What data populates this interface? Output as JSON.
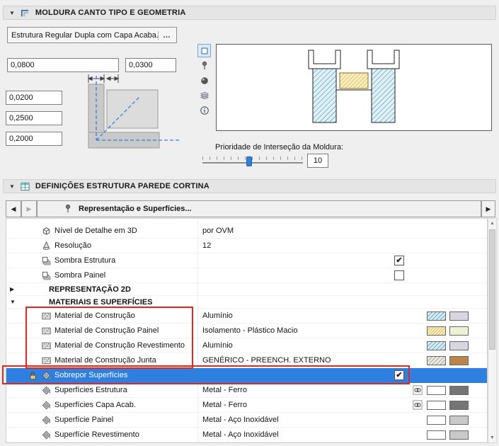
{
  "icons": {
    "panel_collapse": "▼",
    "group_collapsed": "▶",
    "group_expanded": "▼",
    "nav_left": "◀",
    "nav_right": "▶",
    "check": "✔",
    "scroll_up": "▲",
    "scroll_down": "▼"
  },
  "colors": {
    "selection_blue": "#2e7fe0",
    "annotation_red": "#e0281c",
    "slider_handle_blue": "#2e7fe0",
    "aluminium_hatch_bg": "#d9edf4",
    "aluminium_solid": "#d8d5e0",
    "insulation_hatch_bg": "#faf0c0",
    "insulation_solid": "#eef2d5",
    "generic_hatch_bg": "#e9e9e1",
    "generic_solid": "#b9854c",
    "metal_dark": "#757575",
    "metal_light": "#c9c9c9"
  },
  "panel_frame": {
    "title": "MOLDURA CANTO TIPO E GEOMETRIA",
    "structure_button_label": "Estrutura Regular Dupla com Capa Acaba...",
    "structure_button_more": "…",
    "width_value": "0,0800",
    "depth_value": "0,0300",
    "dim_a_value": "0,0200",
    "dim_b_value": "0,2500",
    "dim_c_value": "0,2000",
    "priority_label": "Prioridade de Interseção da Moldura:",
    "priority_value": "10"
  },
  "panel_settings": {
    "title": "DEFINIÇÕES ESTRUTURA PAREDE CORTINA",
    "page_selector_label": "Representação e Superfícies...",
    "rows": [
      {
        "label": "Nível de Detalhe em 3D",
        "value": "por OVM"
      },
      {
        "label": "Resolução",
        "value": "12"
      },
      {
        "label": "Sombra Estrutura",
        "checkbox": "checked"
      },
      {
        "label": "Sombra Painel",
        "checkbox": "unchecked"
      },
      {
        "label": "REPRESENTAÇÃO 2D",
        "group": true,
        "expanded": false
      },
      {
        "label": "MATERIAIS E SUPERFÍCIES",
        "group": true,
        "expanded": true
      },
      {
        "label": "Material de Construção",
        "value": "Alumínio",
        "swatches": [
          "aluminium-hatch",
          "aluminium-solid"
        ]
      },
      {
        "label": "Material de Construção Painel",
        "value": "Isolamento - Plástico Macio",
        "swatches": [
          "insulation-hatch",
          "insulation-solid"
        ]
      },
      {
        "label": "Material de Construção Revestimento",
        "value": "Alumínio",
        "swatches": [
          "aluminium-hatch",
          "aluminium-solid"
        ]
      },
      {
        "label": "Material de Construção Junta",
        "value": "GENÉRICO - PREENCH. EXTERNO",
        "swatches": [
          "generic-hatch",
          "generic-solid"
        ]
      },
      {
        "label": "Sobrepor Superfícies",
        "checkbox": "checked",
        "selected": true
      },
      {
        "label": "Superfícies Estrutura",
        "value": "Metal - Ferro",
        "linked": true,
        "swatches": [
          "white",
          "dark-gray"
        ]
      },
      {
        "label": "Superfícies Capa Acab.",
        "value": "Metal - Ferro",
        "linked": true,
        "swatches": [
          "white",
          "dark-gray"
        ]
      },
      {
        "label": "Superfície Painel",
        "value": "Metal - Aço Inoxidável",
        "swatches": [
          "white",
          "light-gray"
        ]
      },
      {
        "label": "Superfície Revestimento",
        "value": "Metal - Aço Inoxidável",
        "swatches": [
          "white",
          "light-gray"
        ]
      }
    ]
  }
}
